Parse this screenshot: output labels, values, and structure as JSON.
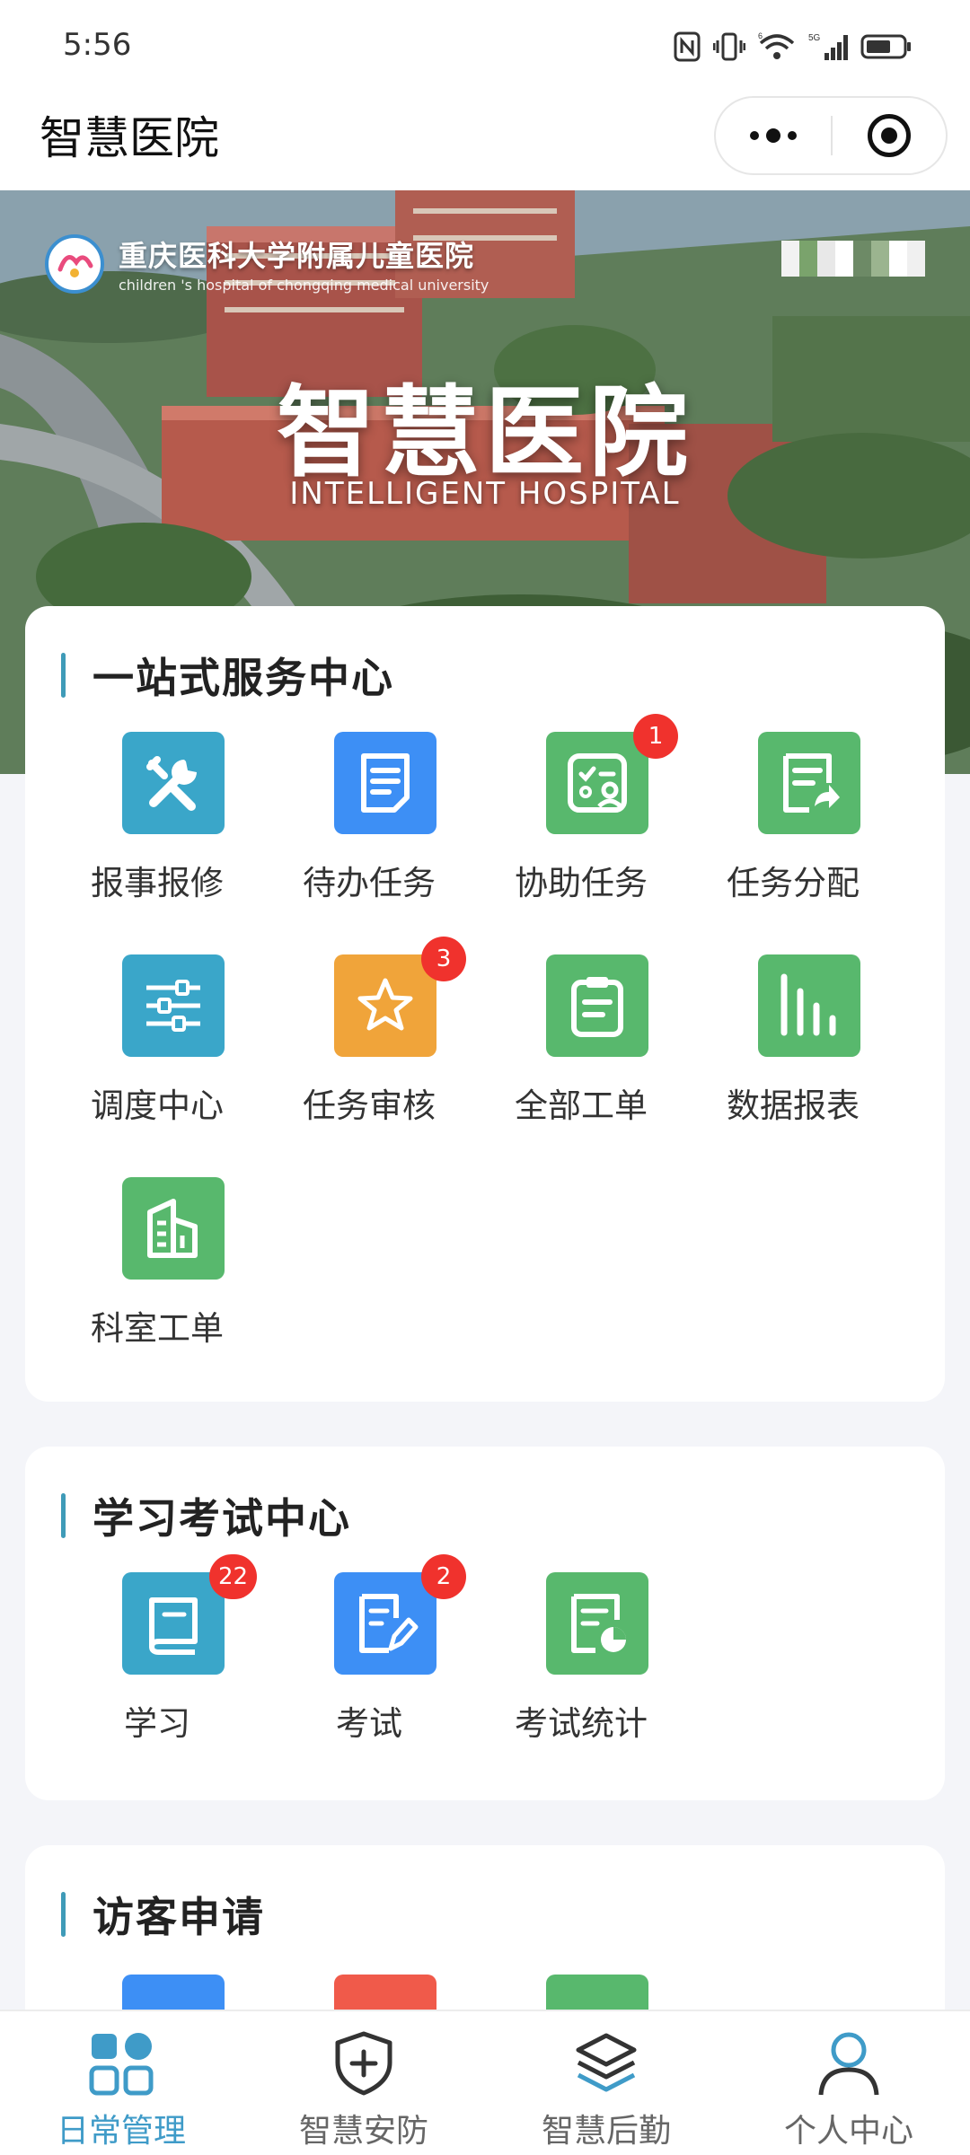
{
  "status_bar": {
    "time": "5:56",
    "signal_label": "5G",
    "wifi_label": "6"
  },
  "nav": {
    "title": "智慧医院"
  },
  "banner": {
    "hospital_name": "重庆医科大学附属儿童医院",
    "hospital_name_en": "children 's hospital of chongqing medical university",
    "title": "智慧医院",
    "subtitle": "INTELLIGENT HOSPITAL"
  },
  "service_center": {
    "title": "一站式服务中心",
    "items": [
      {
        "label": "报事报修",
        "icon": "tools-icon",
        "color": "#3aa6c9"
      },
      {
        "label": "待办任务",
        "icon": "document-icon",
        "color": "#3d8ff5"
      },
      {
        "label": "协助任务",
        "icon": "assist-task-icon",
        "color": "#58b86d",
        "badge": "1"
      },
      {
        "label": "任务分配",
        "icon": "assign-task-icon",
        "color": "#58b86d"
      },
      {
        "label": "调度中心",
        "icon": "sliders-icon",
        "color": "#3aa6c9"
      },
      {
        "label": "任务审核",
        "icon": "star-icon",
        "color": "#f0a43a",
        "badge": "3"
      },
      {
        "label": "全部工单",
        "icon": "clipboard-icon",
        "color": "#58b86d"
      },
      {
        "label": "数据报表",
        "icon": "bar-chart-icon",
        "color": "#58b86d"
      },
      {
        "label": "科室工单",
        "icon": "building-icon",
        "color": "#58b86d"
      }
    ]
  },
  "exam_center": {
    "title": "学习考试中心",
    "items": [
      {
        "label": "学习",
        "icon": "book-icon",
        "color": "#3aa6c9",
        "badge": "22"
      },
      {
        "label": "考试",
        "icon": "exam-pen-icon",
        "color": "#3d8ff5",
        "badge": "2"
      },
      {
        "label": "考试统计",
        "icon": "report-pie-icon",
        "color": "#58b86d"
      }
    ]
  },
  "visitor": {
    "title": "访客申请"
  },
  "tab_bar": {
    "items": [
      {
        "label": "日常管理",
        "icon": "grid-icon",
        "active": true
      },
      {
        "label": "智慧安防",
        "icon": "shield-plus-icon",
        "active": false
      },
      {
        "label": "智慧后勤",
        "icon": "layers-icon",
        "active": false
      },
      {
        "label": "个人中心",
        "icon": "user-icon",
        "active": false
      }
    ]
  }
}
